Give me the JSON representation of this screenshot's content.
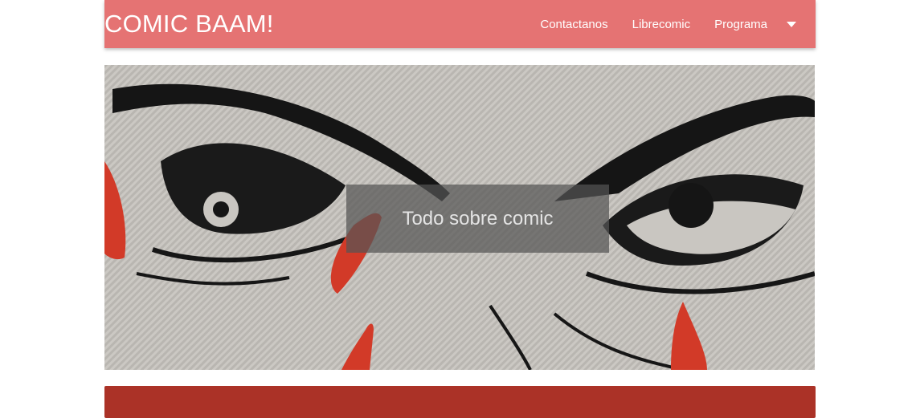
{
  "navbar": {
    "brand": "COMIC BAAM!",
    "links": [
      {
        "label": "Contactanos"
      },
      {
        "label": "Librecomic"
      },
      {
        "label": "Programa"
      }
    ],
    "dropdown_icon": "caret-down-icon",
    "background": "#e57373"
  },
  "hero": {
    "caption": "Todo sobre comic",
    "image": "comic-eyes-illustration"
  },
  "colors": {
    "accent_bar": "#ab3227",
    "caption_bg": "#555555"
  }
}
